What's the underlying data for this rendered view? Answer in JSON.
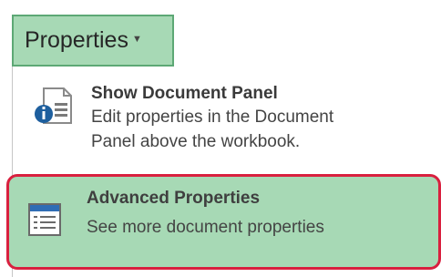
{
  "ribbon": {
    "properties_label": "Properties",
    "caret_icon": "chevron-down-icon"
  },
  "menu": {
    "items": [
      {
        "title": "Show Document Panel",
        "description_line1": "Edit properties in the Document",
        "description_line2": "Panel above the workbook.",
        "icon": "document-panel-info-icon"
      },
      {
        "title": "Advanced Properties",
        "description": "See more document properties",
        "icon": "properties-list-icon"
      }
    ]
  },
  "colors": {
    "button_bg": "#a7d9b5",
    "button_border": "#5da875",
    "highlight_bg": "#a7d9b5",
    "highlight_ring": "#d9203f"
  }
}
